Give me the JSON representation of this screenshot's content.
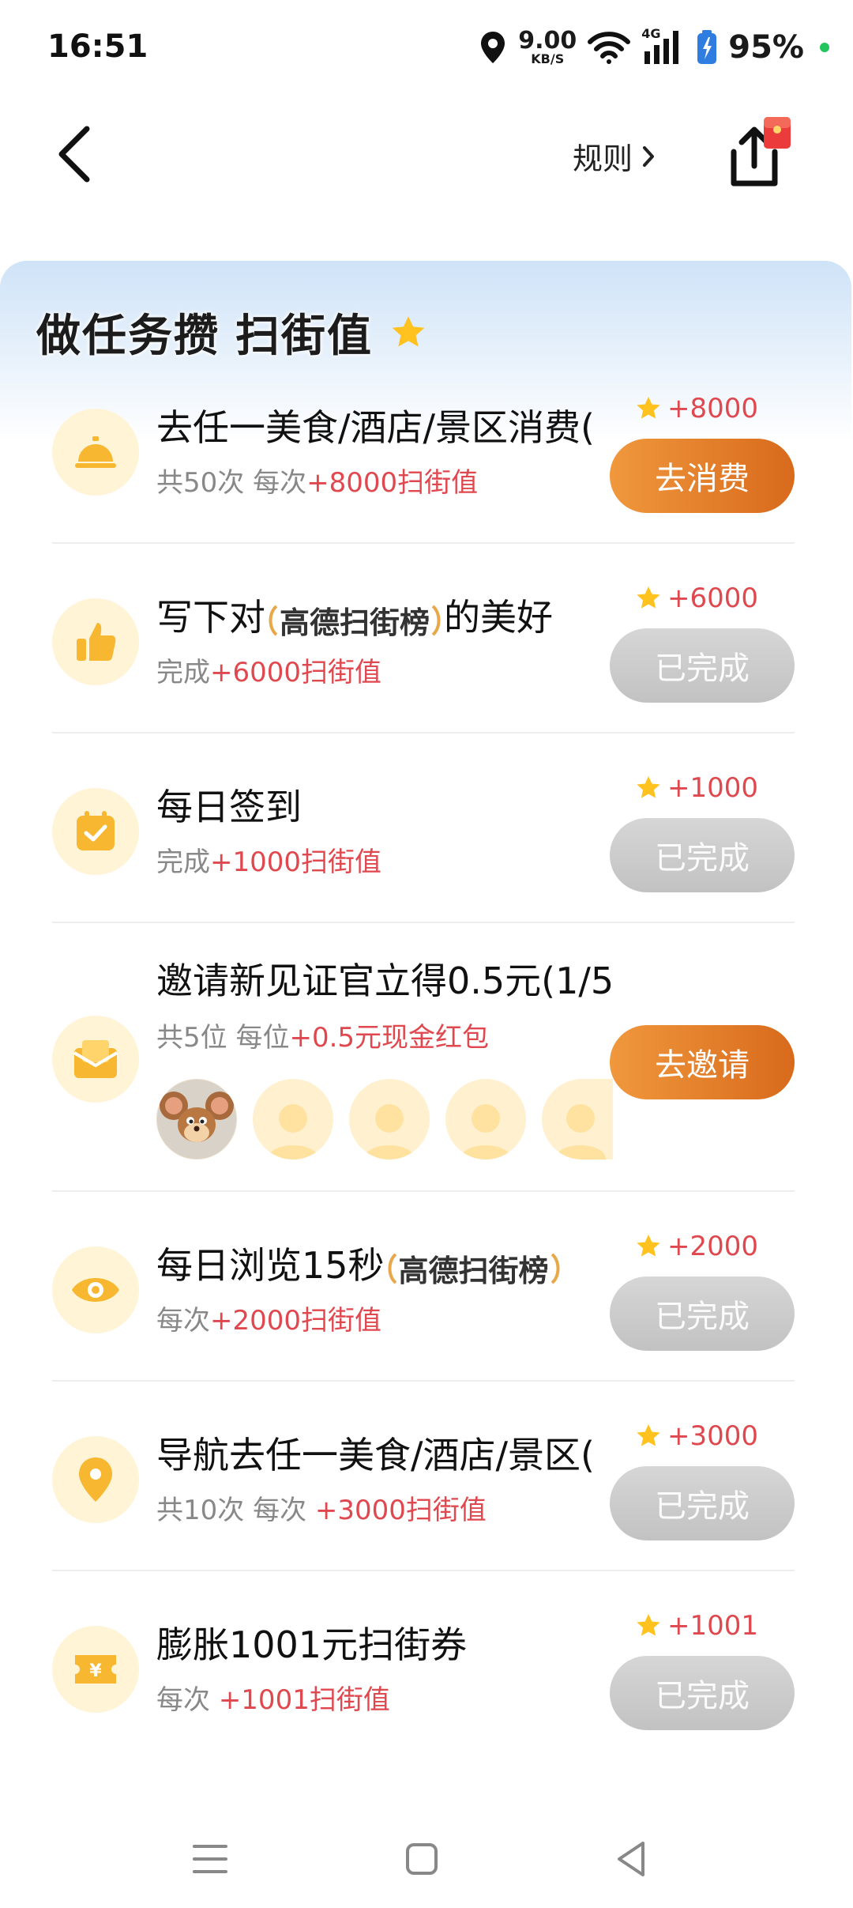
{
  "status_bar": {
    "time": "16:51",
    "speed_value": "9.00",
    "speed_unit": "KB/S",
    "network": "4G",
    "battery": "95%"
  },
  "nav": {
    "rules_label": "规则"
  },
  "panel": {
    "title_a": "做任务攒",
    "title_b": "扫街值"
  },
  "tag": {
    "text": "高德扫街榜"
  },
  "tasks": [
    {
      "title": "去任一美食/酒店/景区消费(",
      "sub_prefix": "共50次 每次",
      "sub_highlight": "+8000扫街值",
      "reward": "+8000",
      "button": "去消费",
      "icon": "food-cloche-icon"
    },
    {
      "title_prefix": "写下对",
      "title_suffix": "的美好",
      "sub_prefix": "完成",
      "sub_highlight": "+6000扫街值",
      "reward": "+6000",
      "button": "已完成",
      "icon": "thumbs-up-icon"
    },
    {
      "title": "每日签到",
      "sub_prefix": "完成",
      "sub_highlight": "+1000扫街值",
      "reward": "+1000",
      "button": "已完成",
      "icon": "calendar-check-icon"
    },
    {
      "title": "邀请新见证官立得0.5元(1/5",
      "sub_prefix": "共5位 每位",
      "sub_highlight": "+0.5元现金红包",
      "button": "去邀请",
      "icon": "envelope-icon"
    },
    {
      "title_prefix": "每日浏览15秒",
      "sub_prefix": "每次",
      "sub_highlight": "+2000扫街值",
      "reward": "+2000",
      "button": "已完成",
      "icon": "eye-icon"
    },
    {
      "title": "导航去任一美食/酒店/景区(",
      "sub_prefix": "共10次 每次 ",
      "sub_highlight": "+3000扫街值",
      "reward": "+3000",
      "button": "已完成",
      "icon": "location-pin-icon"
    },
    {
      "title": "膨胀1001元扫街券",
      "sub_prefix": "每次 ",
      "sub_highlight": "+1001扫街值",
      "reward": "+1001",
      "button": "已完成",
      "icon": "coupon-yen-icon"
    }
  ],
  "colors": {
    "accent_orange": "#e07b26",
    "reward_red": "#e0484f",
    "done_gray": "#c8c8c8",
    "icon_bg": "#fff4d6",
    "icon_fg": "#f7b731"
  }
}
